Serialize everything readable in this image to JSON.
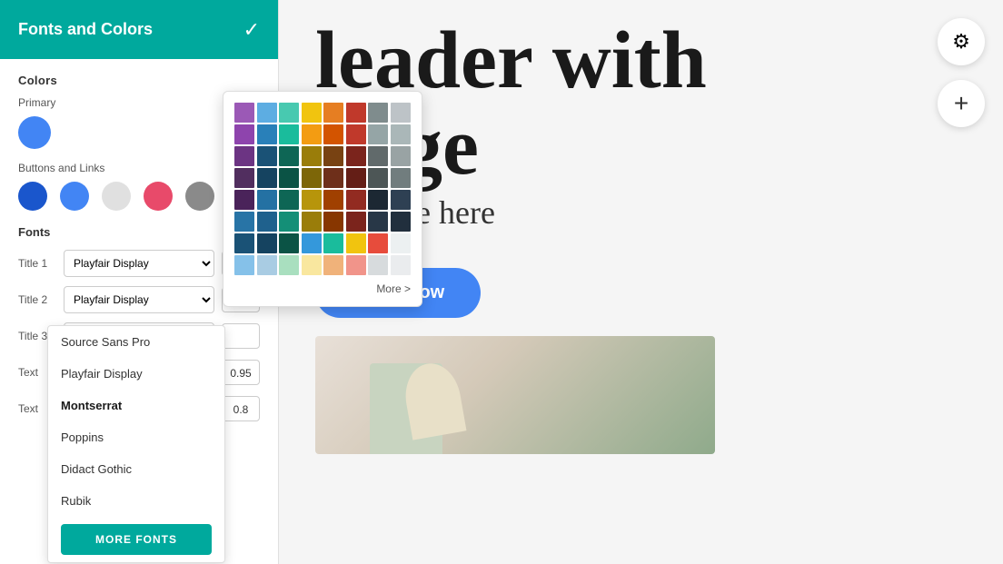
{
  "panel": {
    "title": "Fonts and Colors",
    "check_icon": "✓",
    "colors_section": "Colors",
    "primary_label": "Primary",
    "buttons_links_label": "Buttons and  Links",
    "primary_color": "#4285f4",
    "button_colors": [
      {
        "color": "#1a56cc",
        "id": "blue-dark"
      },
      {
        "color": "#4285f4",
        "id": "blue-medium"
      },
      {
        "color": "#e0e0e0",
        "id": "gray-light"
      },
      {
        "color": "#e84a6a",
        "id": "pink"
      },
      {
        "color": "#8a8a8a",
        "id": "gray-dark"
      }
    ],
    "fonts_section": "Fonts",
    "font_rows": [
      {
        "label": "Title 1",
        "value": "Playfair Display",
        "size": ""
      },
      {
        "label": "Title 2",
        "value": "Playfair Display",
        "size": ""
      },
      {
        "label": "Title 3",
        "value": "Montserrat",
        "size": ""
      },
      {
        "label": "Text",
        "value": "Source Sans Pro",
        "size": "0.95"
      },
      {
        "label": "Text",
        "value": "Playfair Display",
        "size": "0.8"
      }
    ]
  },
  "font_dropdown": {
    "items": [
      {
        "label": "Source Sans Pro",
        "selected": false
      },
      {
        "label": "Playfair Display",
        "selected": false
      },
      {
        "label": "Montserrat",
        "selected": true
      },
      {
        "label": "Poppins",
        "selected": false
      },
      {
        "label": "Didact Gothic",
        "selected": false
      },
      {
        "label": "Rubik",
        "selected": false
      }
    ],
    "more_fonts_btn": "MORE FONTS"
  },
  "color_palette": {
    "more_label": "More >",
    "colors": [
      "#9b59b6",
      "#5dade2",
      "#48c9b0",
      "#f1c40f",
      "#e67e22",
      "#c0392b",
      "#7f8c8d",
      "#bdc3c7",
      "#8e44ad",
      "#2980b9",
      "#1abc9c",
      "#f39c12",
      "#d35400",
      "#c0392b",
      "#95a5a6",
      "#aab7b8",
      "#6c3483",
      "#1a5276",
      "#0e6655",
      "#9a7d0a",
      "#784212",
      "#7b241c",
      "#616a6b",
      "#99a3a4",
      "#512e5f",
      "#154360",
      "#0b5345",
      "#7d6608",
      "#6e2f1a",
      "#641e16",
      "#4d5656",
      "#717d7e",
      "#4a235a",
      "#2471a3",
      "#0e6655",
      "#b7950b",
      "#a04000",
      "#922b21",
      "#1c2833",
      "#2e4053",
      "#2874a6",
      "#1f618d",
      "#148f77",
      "#9a7d0a",
      "#873600",
      "#7b241c",
      "#283747",
      "#212f3d",
      "#1a5276",
      "#154360",
      "#0b5345",
      "#3498db",
      "#1abc9c",
      "#f1c40f",
      "#e74c3c",
      "#ecf0f1",
      "#85c1e9",
      "#a9cce3",
      "#a9dfbf",
      "#f9e79f",
      "#f0b27a",
      "#f1948a",
      "#d7dbdd",
      "#eaecee"
    ]
  },
  "hero": {
    "heading_line1": "leader with",
    "heading_line2": "nage",
    "subtitle": "r subtitle here",
    "learn_how": "Learn How"
  },
  "toolbar": {
    "settings_icon": "⚙",
    "add_icon": "+"
  }
}
